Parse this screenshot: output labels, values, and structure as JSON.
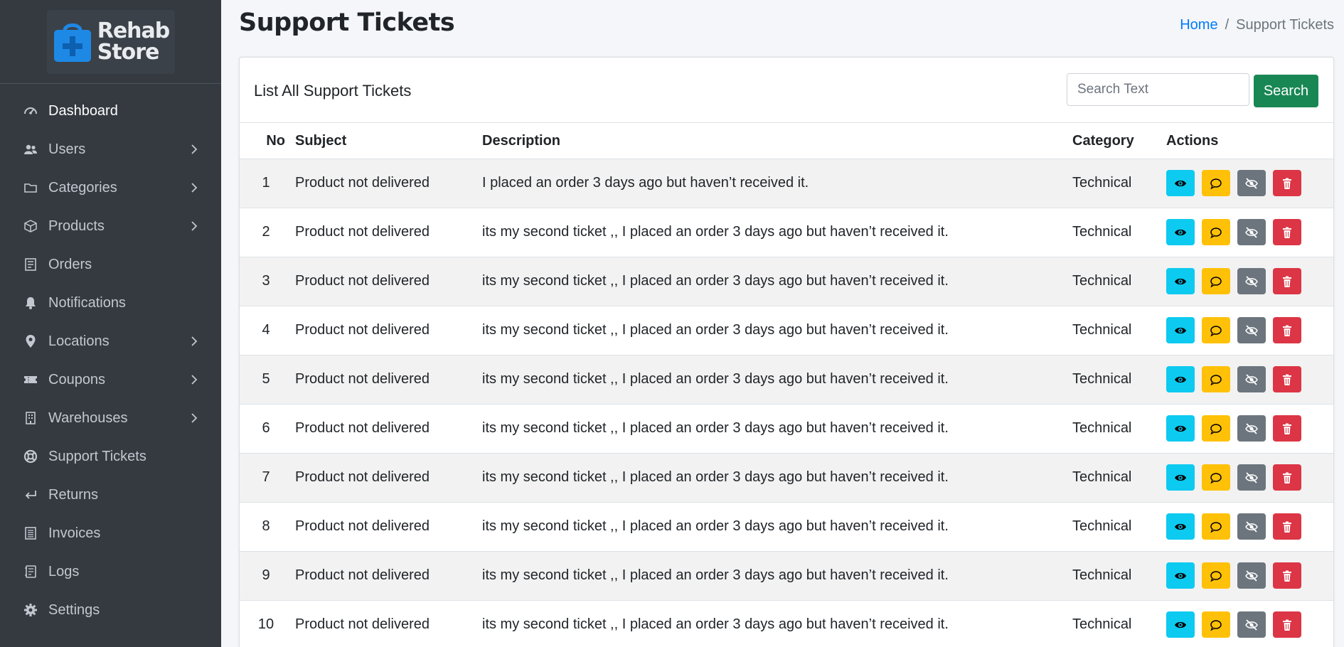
{
  "brand": {
    "line1": "Rehab",
    "line2": "Store"
  },
  "sidebar": {
    "items": [
      {
        "label": "Dashboard",
        "icon": "dashboard-icon",
        "chevron": false,
        "active": true
      },
      {
        "label": "Users",
        "icon": "users-icon",
        "chevron": true
      },
      {
        "label": "Categories",
        "icon": "folder-icon",
        "chevron": true
      },
      {
        "label": "Products",
        "icon": "box-icon",
        "chevron": true
      },
      {
        "label": "Orders",
        "icon": "receipt-icon",
        "chevron": false
      },
      {
        "label": "Notifications",
        "icon": "bell-icon",
        "chevron": false
      },
      {
        "label": "Locations",
        "icon": "map-pin-icon",
        "chevron": true
      },
      {
        "label": "Coupons",
        "icon": "ticket-icon",
        "chevron": true
      },
      {
        "label": "Warehouses",
        "icon": "building-icon",
        "chevron": true
      },
      {
        "label": "Support Tickets",
        "icon": "lifebuoy-icon",
        "chevron": false
      },
      {
        "label": "Returns",
        "icon": "return-icon",
        "chevron": false
      },
      {
        "label": "Invoices",
        "icon": "invoice-icon",
        "chevron": false
      },
      {
        "label": "Logs",
        "icon": "log-icon",
        "chevron": false
      },
      {
        "label": "Settings",
        "icon": "gear-icon",
        "chevron": false
      }
    ]
  },
  "header": {
    "title": "Support Tickets",
    "breadcrumb": {
      "home": "Home",
      "separator": "/",
      "current": "Support Tickets"
    }
  },
  "card": {
    "title": "List All Support Tickets",
    "search": {
      "placeholder": "Search Text",
      "value": "",
      "button": "Search"
    }
  },
  "table": {
    "headers": {
      "no": "No",
      "subject": "Subject",
      "description": "Description",
      "category": "Category",
      "actions": "Actions"
    },
    "rows": [
      {
        "no": "1",
        "subject": "Product not delivered",
        "description": "I placed an order 3 days ago but haven’t received it.",
        "category": "Technical"
      },
      {
        "no": "2",
        "subject": "Product not delivered",
        "description": "its my second ticket ,, I placed an order 3 days ago but haven’t received it.",
        "category": "Technical"
      },
      {
        "no": "3",
        "subject": "Product not delivered",
        "description": "its my second ticket ,, I placed an order 3 days ago but haven’t received it.",
        "category": "Technical"
      },
      {
        "no": "4",
        "subject": "Product not delivered",
        "description": "its my second ticket ,, I placed an order 3 days ago but haven’t received it.",
        "category": "Technical"
      },
      {
        "no": "5",
        "subject": "Product not delivered",
        "description": "its my second ticket ,, I placed an order 3 days ago but haven’t received it.",
        "category": "Technical"
      },
      {
        "no": "6",
        "subject": "Product not delivered",
        "description": "its my second ticket ,, I placed an order 3 days ago but haven’t received it.",
        "category": "Technical"
      },
      {
        "no": "7",
        "subject": "Product not delivered",
        "description": "its my second ticket ,, I placed an order 3 days ago but haven’t received it.",
        "category": "Technical"
      },
      {
        "no": "8",
        "subject": "Product not delivered",
        "description": "its my second ticket ,, I placed an order 3 days ago but haven’t received it.",
        "category": "Technical"
      },
      {
        "no": "9",
        "subject": "Product not delivered",
        "description": "its my second ticket ,, I placed an order 3 days ago but haven’t received it.",
        "category": "Technical"
      },
      {
        "no": "10",
        "subject": "Product not delivered",
        "description": "its my second ticket ,, I placed an order 3 days ago but haven’t received it.",
        "category": "Technical"
      }
    ],
    "action_icons": [
      "eye-icon",
      "chat-icon",
      "eye-slash-icon",
      "trash-icon"
    ]
  },
  "colors": {
    "sidebar_bg": "#343a40",
    "brand_blue": "#1e88e5",
    "link": "#007bff",
    "search_button": "#198754",
    "view": "#0dcaf0",
    "reply": "#ffc107",
    "hide": "#6c757d",
    "delete": "#dc3545"
  }
}
